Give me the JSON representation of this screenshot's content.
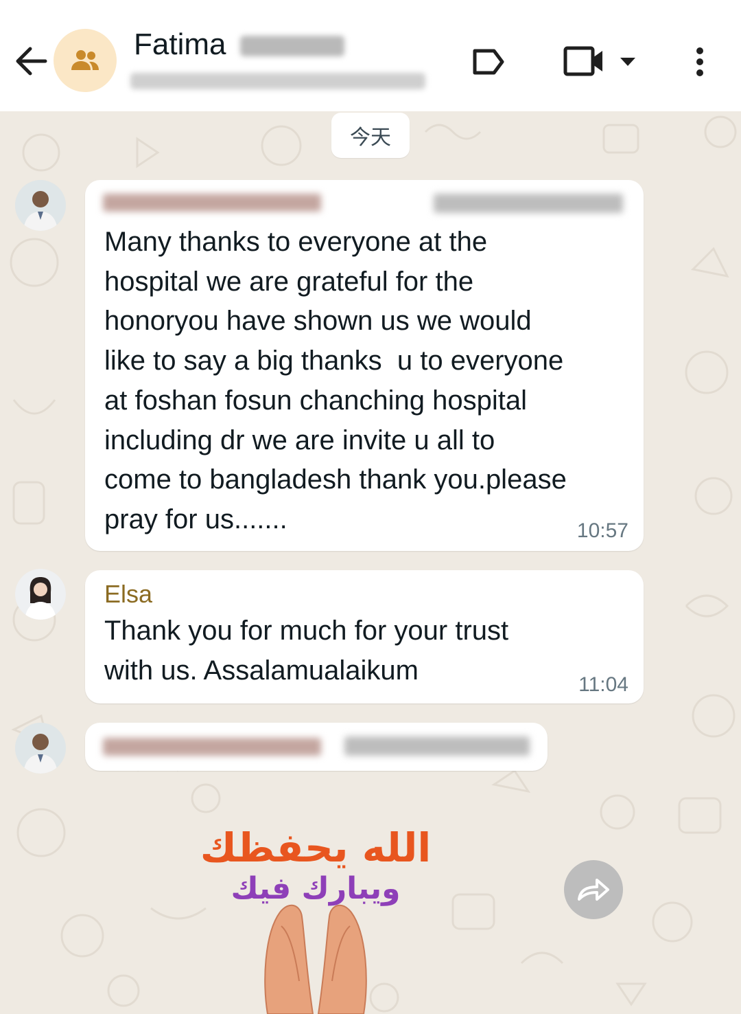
{
  "header": {
    "contact_name": "Fatima",
    "icons": [
      "back-arrow-icon",
      "group-avatar-icon",
      "label-icon",
      "video-call-icon",
      "caret-down-icon",
      "more-vert-icon"
    ]
  },
  "chat": {
    "date_label": "今天",
    "messages": [
      {
        "sender": "",
        "text": "Many thanks to everyone at the\nhospital we are grateful for the\nhonoryou have shown us we would\nlike to say a big thanks  u to everyone\nat foshan fosun chanching hospital\nincluding dr we are invite u all to\ncome to bangladesh thank you.please\npray for us.......",
        "time": "10:57"
      },
      {
        "sender": "Elsa",
        "text": "Thank you for much for your trust\nwith us. Assalamualaikum",
        "time": "11:04"
      },
      {
        "sender": "",
        "sticker_line1": "الله يحفظك",
        "sticker_line2": "ويبارك فيك"
      }
    ]
  },
  "colors": {
    "chat_background": "#efeae2",
    "bubble": "#ffffff",
    "sender_name": "#8b6b22",
    "timestamp": "#667781",
    "group_avatar_bg": "#fbe7c6",
    "group_avatar_fg": "#c98a2b",
    "sticker_orange": "#e8561f",
    "sticker_purple": "#8e3fb8"
  }
}
